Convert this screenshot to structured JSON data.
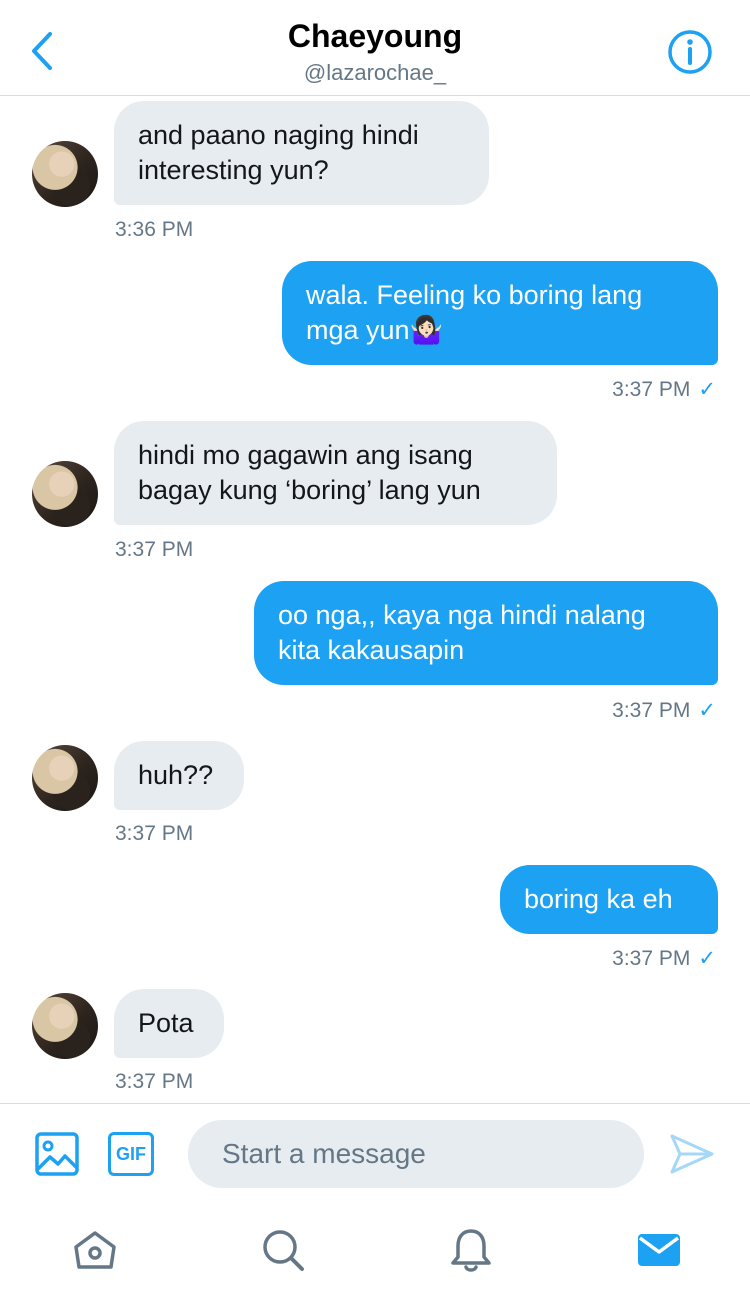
{
  "header": {
    "title": "Chaeyoung",
    "subtitle": "@lazarochae_"
  },
  "messages": [
    {
      "direction": "in",
      "text": "and paano naging hindi\ninteresting yun?",
      "time": "3:36 PM"
    },
    {
      "direction": "out",
      "text": "wala. Feeling ko boring lang\nmga yun🤷🏻‍♀️",
      "time": "3:37 PM",
      "status": "✓"
    },
    {
      "direction": "in",
      "text": "hindi mo gagawin ang isang\nbagay kung ‘boring’ lang yun",
      "time": "3:37 PM"
    },
    {
      "direction": "out",
      "text": "oo nga,, kaya nga hindi nalang\nkita kakausapin",
      "time": "3:37 PM",
      "status": "✓"
    },
    {
      "direction": "in",
      "text": "huh??",
      "time": "3:37 PM"
    },
    {
      "direction": "out",
      "text": "boring ka eh",
      "time": "3:37 PM",
      "status": "✓"
    },
    {
      "direction": "in",
      "text": "Pota",
      "time": "3:37 PM"
    }
  ],
  "composer": {
    "gif_label": "GIF",
    "placeholder": "Start a message"
  },
  "icons": {
    "back": "chevron-left-icon",
    "info": "info-icon",
    "image": "image-icon",
    "send": "send-icon",
    "home": "home-icon",
    "search": "search-icon",
    "notifications": "bell-icon",
    "messages": "mail-icon"
  },
  "colors": {
    "accent": "#1da1f2",
    "incoming_bubble": "#e6ecf0",
    "muted_text": "#657786"
  }
}
